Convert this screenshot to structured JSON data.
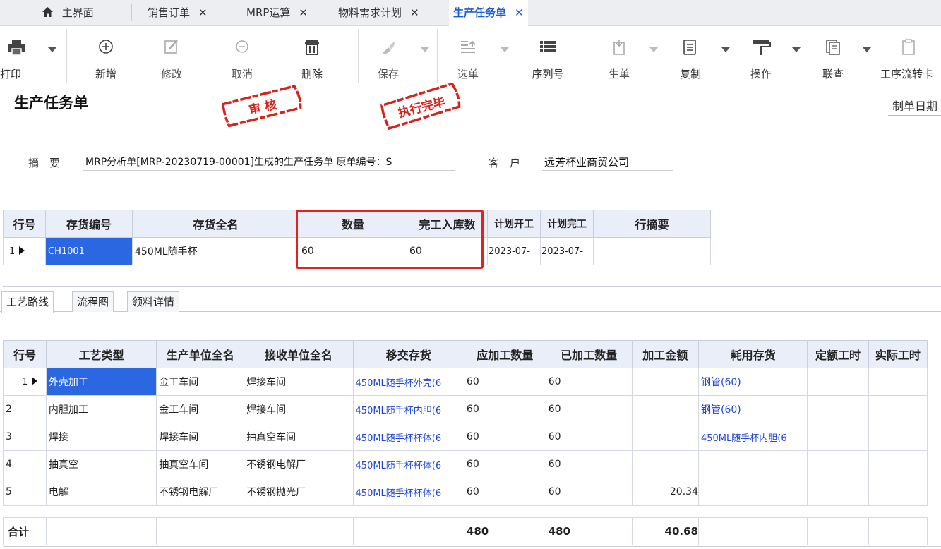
{
  "tabs": [
    {
      "label": "主界面",
      "icon": "home-icon",
      "closable": false
    },
    {
      "label": "销售订单",
      "closable": true
    },
    {
      "label": "MRP运算",
      "closable": true
    },
    {
      "label": "物料需求计划",
      "closable": true
    },
    {
      "label": "生产任务单",
      "closable": true,
      "active": true
    }
  ],
  "tab_close_glyph": "✕",
  "toolbar": {
    "print": "打印",
    "add": "新增",
    "edit": "修改",
    "cancel": "取消",
    "delete": "删除",
    "save": "保存",
    "select": "选单",
    "serial": "序列号",
    "generate": "生单",
    "copy": "复制",
    "operate": "操作",
    "link_query": "联查",
    "process_card": "工序流转卡"
  },
  "document": {
    "title": "生产任务单",
    "stamp_audit": "审 核",
    "stamp_done": "执行完毕",
    "create_date_label": "制单日期",
    "summary_label": "摘　要",
    "summary_value": "MRP分析单[MRP-20230719-00001]生成的生产任务单 原单编号：S",
    "customer_label": "客　户",
    "customer_value": "远芳杯业商贸公司"
  },
  "main_grid": {
    "headers": [
      "行号",
      "存货编号",
      "存货全名",
      "数量",
      "完工入库数",
      "计划开工",
      "计划完工",
      "行摘要"
    ],
    "rows": [
      {
        "no": "1",
        "code": "CH1001",
        "name": "450ML随手杯",
        "qty": "60",
        "done": "60",
        "start": "2023-07-",
        "end": "2023-07-",
        "memo": ""
      }
    ]
  },
  "sub_tabs": [
    "工艺路线",
    "流程图",
    "领料详情"
  ],
  "process_grid": {
    "headers": [
      "行号",
      "工艺类型",
      "生产单位全名",
      "接收单位全名",
      "移交存货",
      "应加工数量",
      "已加工数量",
      "加工金额",
      "耗用存货",
      "定额工时",
      "实际工时"
    ],
    "rows": [
      {
        "no": "1",
        "type": "外壳加工",
        "unit": "金工车间",
        "recv": "焊接车间",
        "item": "450ML随手杯外壳(6",
        "qty": "60",
        "done": "60",
        "amount": "",
        "consume": "钢管(60)",
        "std": "",
        "act": ""
      },
      {
        "no": "2",
        "type": "内胆加工",
        "unit": "金工车间",
        "recv": "焊接车间",
        "item": "450ML随手杯内胆(6",
        "qty": "60",
        "done": "60",
        "amount": "",
        "consume": "钢管(60)",
        "std": "",
        "act": ""
      },
      {
        "no": "3",
        "type": "焊接",
        "unit": "焊接车间",
        "recv": "抽真空车间",
        "item": "450ML随手杯杯体(6",
        "qty": "60",
        "done": "60",
        "amount": "",
        "consume": "450ML随手杯内胆(6",
        "std": "",
        "act": ""
      },
      {
        "no": "4",
        "type": "抽真空",
        "unit": "抽真空车间",
        "recv": "不锈钢电解厂",
        "item": "450ML随手杯杯体(6",
        "qty": "60",
        "done": "60",
        "amount": "",
        "consume": "",
        "std": "",
        "act": ""
      },
      {
        "no": "5",
        "type": "电解",
        "unit": "不锈钢电解厂",
        "recv": "不锈钢抛光厂",
        "item": "450ML随手杯杯体(6",
        "qty": "60",
        "done": "60",
        "amount": "20.34",
        "consume": "",
        "std": "",
        "act": ""
      }
    ],
    "total": {
      "label": "合计",
      "qty": "480",
      "done": "480",
      "amount": "40.68"
    }
  },
  "colors": {
    "accent": "#1a5ed1",
    "selected": "#2a67e0",
    "highlight_box": "#e8201a",
    "stamp": "#d8231c"
  }
}
